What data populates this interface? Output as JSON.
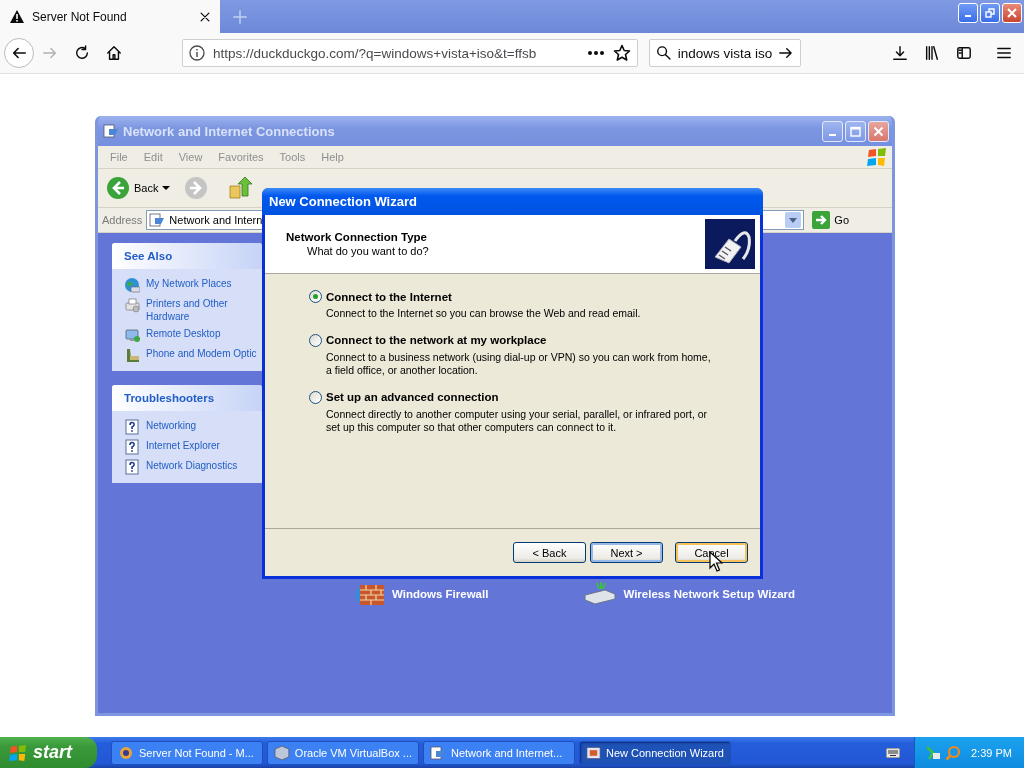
{
  "browser": {
    "tab": {
      "title": "Server Not Found"
    },
    "url": "https://duckduckgo.com/?q=windows+vista+iso&t=ffsb",
    "search": {
      "value": "indows vista iso"
    }
  },
  "xp_window": {
    "title": "Network and Internet Connections",
    "menu": [
      "File",
      "Edit",
      "View",
      "Favorites",
      "Tools",
      "Help"
    ],
    "back_label": "Back",
    "address": {
      "label": "Address",
      "value": "Network and Intern",
      "go": "Go"
    },
    "panels": [
      {
        "title": "See Also",
        "items": [
          "My Network Places",
          "Printers and Other Hardware",
          "Remote Desktop",
          "Phone and Modem Optic"
        ]
      },
      {
        "title": "Troubleshooters",
        "items": [
          "Networking",
          "Internet Explorer",
          "Network Diagnostics"
        ]
      }
    ],
    "tasks": [
      {
        "label": "Windows Firewall"
      },
      {
        "label": "Wireless Network Setup Wizard"
      }
    ]
  },
  "wizard": {
    "title": "New Connection Wizard",
    "heading": "Network Connection Type",
    "subheading": "What do you want to do?",
    "options": [
      {
        "label": "Connect to the Internet",
        "description": "Connect to the Internet so you can browse the Web and read email.",
        "selected": true
      },
      {
        "label": "Connect to the network at my workplace",
        "description": "Connect to a business network (using dial-up or VPN) so you can work from home, a field office, or another location.",
        "selected": false
      },
      {
        "label": "Set up an advanced connection",
        "description": "Connect directly to another computer using your serial, parallel, or infrared port, or set up this computer so that other computers can connect to it.",
        "selected": false
      }
    ],
    "buttons": [
      {
        "label": "< Back",
        "kind": "normal"
      },
      {
        "label": "Next >",
        "kind": "default"
      },
      {
        "label": "Cancel",
        "kind": "hover"
      }
    ]
  },
  "taskbar": {
    "start": "start",
    "tasks": [
      {
        "label": "Server Not Found - M...",
        "selected": false
      },
      {
        "label": "Oracle VM VirtualBox ...",
        "selected": false
      },
      {
        "label": "Network and Internet...",
        "selected": false
      },
      {
        "label": "New Connection Wizard",
        "selected": true
      }
    ],
    "clock": "2:39 PM"
  }
}
